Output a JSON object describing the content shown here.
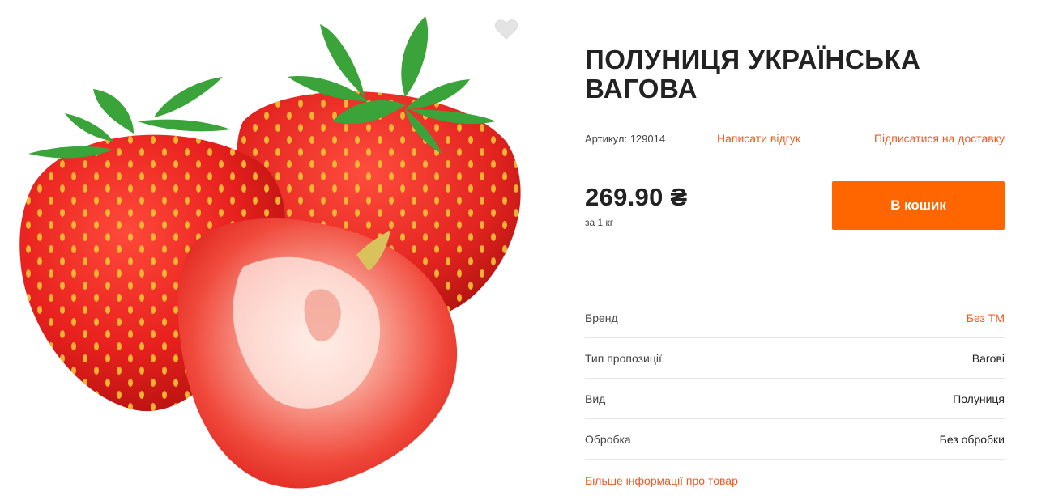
{
  "product": {
    "title": "ПОЛУНИЦЯ УКРАЇНСЬКА ВАГОВА",
    "sku_label": "Артикул:",
    "sku_value": "129014",
    "review_link": "Написати відгук",
    "delivery_link": "Підписатися на доставку",
    "price": "269.90 ₴",
    "unit": "за 1 кг",
    "cart_button": "В кошик",
    "more_info_link": "Більше інформації про товар"
  },
  "properties": [
    {
      "name": "Бренд",
      "value": "Без ТМ",
      "accent": true
    },
    {
      "name": "Тип пропозиції",
      "value": "Вагові",
      "accent": false
    },
    {
      "name": "Вид",
      "value": "Полуниця",
      "accent": false
    },
    {
      "name": "Обробка",
      "value": "Без обробки",
      "accent": false
    }
  ],
  "colors": {
    "accent": "#ff6600",
    "link": "#f15a22",
    "text": "#222222"
  },
  "icons": {
    "favorite": "heart-icon",
    "image": "strawberry-product-image"
  }
}
